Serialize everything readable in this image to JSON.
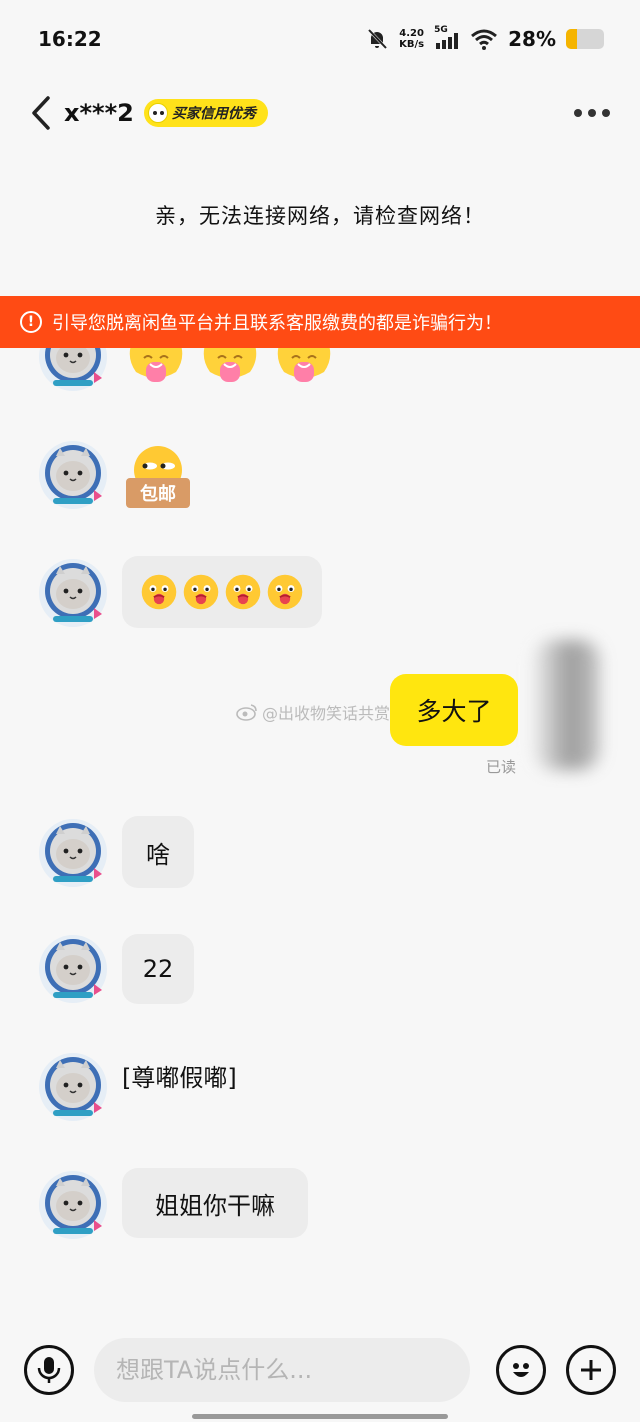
{
  "status_bar": {
    "time": "16:22",
    "net_speed_value": "4.20",
    "net_speed_unit": "KB/s",
    "signal_label": "5G",
    "battery_percent": "28%",
    "battery_level": 0.28
  },
  "header": {
    "user_name": "x***2",
    "credit_badge": "买家信用优秀"
  },
  "network_error": "亲，无法连接网络，请检查网络！",
  "warning_banner": "引导您脱离闲鱼平台并且联系客服缴费的都是诈骗行为！",
  "messages": [
    {
      "emoji_label": "包邮"
    },
    {
      "text": "多大了",
      "status": "已读"
    },
    {
      "text": "啥"
    },
    {
      "text": "22"
    },
    {
      "text": "[尊嘟假嘟]"
    },
    {
      "text": "姐姐你干嘛"
    }
  ],
  "watermark": "@出收物笑话共赏",
  "input": {
    "placeholder": "想跟TA说点什么..."
  },
  "icons": [
    "back-icon",
    "more-icon",
    "mute-bell-icon",
    "signal-icon",
    "wifi-icon",
    "battery-icon",
    "warning-icon",
    "microphone-icon",
    "emoji-icon",
    "plus-icon",
    "weibo-icon"
  ],
  "colors": {
    "accent_yellow": "#ffe60f",
    "warning_red": "#ff4b14"
  }
}
